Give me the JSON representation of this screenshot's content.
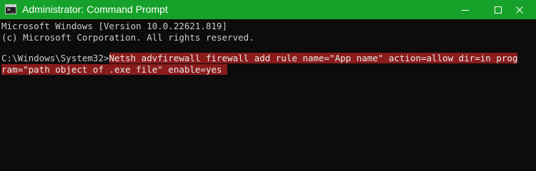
{
  "window": {
    "title": "Administrator: Command Prompt",
    "icon": "command-prompt-icon",
    "title_bar_color": "#16a22a"
  },
  "controls": {
    "minimize": "minimize-icon",
    "maximize": "maximize-icon",
    "close": "close-icon"
  },
  "console": {
    "background": "#0c0c0c",
    "text_color": "#cccccc",
    "highlight_color": "#8a1c1c",
    "banner_version": "Microsoft Windows [Version 10.0.22621.819]",
    "banner_copyright": "(c) Microsoft Corporation. All rights reserved.",
    "prompt": "C:\\Windows\\System32>",
    "command_part1": "Netsh advfirewall firewall add rule name=\"App name\" action=allow dir=in prog",
    "command_part2": "ram=\"path object of .exe file\" enable=yes "
  }
}
